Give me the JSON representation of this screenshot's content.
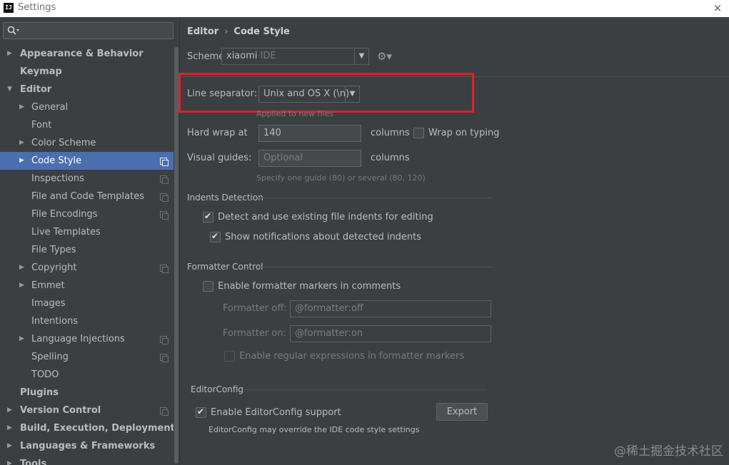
{
  "window": {
    "app_logo": "IJ",
    "title": "Settings",
    "close_icon": "×"
  },
  "sidebar": {
    "items": [
      {
        "label": "Appearance & Behavior",
        "level": 0,
        "bold": true,
        "arrow": "▶",
        "copy": false,
        "selected": false
      },
      {
        "label": "Keymap",
        "level": 0,
        "bold": true,
        "arrow": "",
        "copy": false,
        "selected": false
      },
      {
        "label": "Editor",
        "level": 0,
        "bold": true,
        "arrow": "▼",
        "copy": false,
        "selected": false
      },
      {
        "label": "General",
        "level": 1,
        "bold": false,
        "arrow": "▶",
        "copy": false,
        "selected": false
      },
      {
        "label": "Font",
        "level": 1,
        "bold": false,
        "arrow": "",
        "copy": false,
        "selected": false
      },
      {
        "label": "Color Scheme",
        "level": 1,
        "bold": false,
        "arrow": "▶",
        "copy": false,
        "selected": false
      },
      {
        "label": "Code Style",
        "level": 1,
        "bold": false,
        "arrow": "▶",
        "copy": true,
        "selected": true
      },
      {
        "label": "Inspections",
        "level": 1,
        "bold": false,
        "arrow": "",
        "copy": true,
        "selected": false
      },
      {
        "label": "File and Code Templates",
        "level": 1,
        "bold": false,
        "arrow": "",
        "copy": true,
        "selected": false
      },
      {
        "label": "File Encodings",
        "level": 1,
        "bold": false,
        "arrow": "",
        "copy": true,
        "selected": false
      },
      {
        "label": "Live Templates",
        "level": 1,
        "bold": false,
        "arrow": "",
        "copy": false,
        "selected": false
      },
      {
        "label": "File Types",
        "level": 1,
        "bold": false,
        "arrow": "",
        "copy": false,
        "selected": false
      },
      {
        "label": "Copyright",
        "level": 1,
        "bold": false,
        "arrow": "▶",
        "copy": true,
        "selected": false
      },
      {
        "label": "Emmet",
        "level": 1,
        "bold": false,
        "arrow": "▶",
        "copy": false,
        "selected": false
      },
      {
        "label": "Images",
        "level": 1,
        "bold": false,
        "arrow": "",
        "copy": false,
        "selected": false
      },
      {
        "label": "Intentions",
        "level": 1,
        "bold": false,
        "arrow": "",
        "copy": false,
        "selected": false
      },
      {
        "label": "Language Injections",
        "level": 1,
        "bold": false,
        "arrow": "▶",
        "copy": true,
        "selected": false
      },
      {
        "label": "Spelling",
        "level": 1,
        "bold": false,
        "arrow": "",
        "copy": true,
        "selected": false
      },
      {
        "label": "TODO",
        "level": 1,
        "bold": false,
        "arrow": "",
        "copy": false,
        "selected": false
      },
      {
        "label": "Plugins",
        "level": 0,
        "bold": true,
        "arrow": "",
        "copy": false,
        "selected": false
      },
      {
        "label": "Version Control",
        "level": 0,
        "bold": true,
        "arrow": "▶",
        "copy": true,
        "selected": false
      },
      {
        "label": "Build, Execution, Deployment",
        "level": 0,
        "bold": true,
        "arrow": "▶",
        "copy": false,
        "selected": false
      },
      {
        "label": "Languages & Frameworks",
        "level": 0,
        "bold": true,
        "arrow": "▶",
        "copy": false,
        "selected": false
      },
      {
        "label": "Tools",
        "level": 0,
        "bold": true,
        "arrow": "▶",
        "copy": false,
        "selected": false
      }
    ]
  },
  "breadcrumb": {
    "parent": "Editor",
    "separator": "›",
    "current": "Code Style"
  },
  "scheme": {
    "label": "Scheme:",
    "value": "xiaomi",
    "sub": "IDE",
    "gear": "⚙▾"
  },
  "line_separator": {
    "label": "Line separator:",
    "value": "Unix and OS X (\\n)",
    "hint": "Applied to new files"
  },
  "hard_wrap": {
    "label": "Hard wrap at",
    "value": "140",
    "unit": "columns",
    "wrap_on_typing": "Wrap on typing"
  },
  "visual_guides": {
    "label": "Visual guides:",
    "placeholder": "Optional",
    "unit": "columns",
    "hint": "Specify one guide (80) or several (80, 120)"
  },
  "indents": {
    "title": "Indents Detection",
    "detect": "Detect and use existing file indents for editing",
    "notify": "Show notifications about detected indents"
  },
  "formatter": {
    "title": "Formatter Control",
    "enable": "Enable formatter markers in comments",
    "off_label": "Formatter off:",
    "off_value": "@formatter:off",
    "on_label": "Formatter on:",
    "on_value": "@formatter:on",
    "regex": "Enable regular expressions in formatter markers"
  },
  "editorconfig": {
    "title": "EditorConfig",
    "enable": "Enable EditorConfig support",
    "export": "Export",
    "note": "EditorConfig may override the IDE code style settings"
  },
  "watermark": "@稀土掘金技术社区",
  "colors": {
    "selection": "#4b6eaf",
    "highlight_border": "#e0212a",
    "background": "#3c3f41"
  }
}
